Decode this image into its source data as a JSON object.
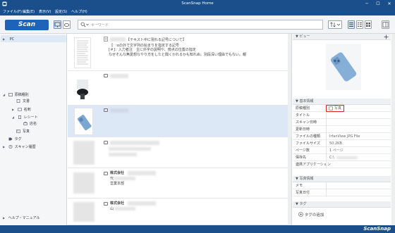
{
  "window": {
    "title": "ScanSnap Home",
    "minimize": "─",
    "maximize": "☐",
    "close": "✕"
  },
  "menu": [
    "ファイル(F)",
    "編集(E)",
    "表示(V)",
    "設定(S)",
    "ヘルプ(H)"
  ],
  "toolbar": {
    "scan_label": "Scan",
    "search_placeholder": "キーワード"
  },
  "tree": {
    "pc": "PC",
    "doc_types": "原稿種別",
    "documents": "文書",
    "business_cards": "名刺",
    "receipts": "レシート",
    "store": "店名",
    "photos": "写真",
    "tags": "タグ",
    "scan_history": "スキャン履歴",
    "help_manual": "ヘルプ・マニュアル"
  },
  "list": {
    "row1_title": "【テキスト中に現れる記号について】",
    "row1_line1": "｛｝:αの外で文字列の始まりを指定する記号",
    "row1_line2": "[＃]：入力者注　主に外字の説明や、傍点の位置の指定",
    "row1_line3": "なぜそんな無愛想なやり方をしたと聞くかれるかも知れぬ。別段深い理由でもない。親",
    "row5_company": "株式会社",
    "row5_l1": "代",
    "row5_l2": "営業本部",
    "row6_company": "株式会社",
    "row6_l1": "山"
  },
  "right": {
    "preview": "ビュー",
    "basic_info": "基本情報",
    "props": [
      {
        "k": "原稿種別",
        "v": "写真"
      },
      {
        "k": "タイトル",
        "v": ""
      },
      {
        "k": "スキャン日時",
        "v": ""
      },
      {
        "k": "更新日時",
        "v": ""
      },
      {
        "k": "ファイルの種類",
        "v": "IrfanView JPG File"
      },
      {
        "k": "ファイルサイズ",
        "v": "50.2KB"
      },
      {
        "k": "ページ数",
        "v": "1 ページ"
      },
      {
        "k": "保存先",
        "v": "C:\\"
      },
      {
        "k": "連携アプリケーション",
        "v": ""
      }
    ],
    "photo_info": "写真情報",
    "photo_props": [
      {
        "k": "メモ",
        "v": ""
      },
      {
        "k": "写真日付",
        "v": ""
      }
    ],
    "tags_head": "タグ",
    "add_tag": "タグの追加"
  },
  "brand": "ScanSnap",
  "colors": {
    "accent": "#1a4f8b",
    "scan_button": "#1f63b8",
    "selection": "#dce8f5",
    "highlight": "#e0241b"
  }
}
